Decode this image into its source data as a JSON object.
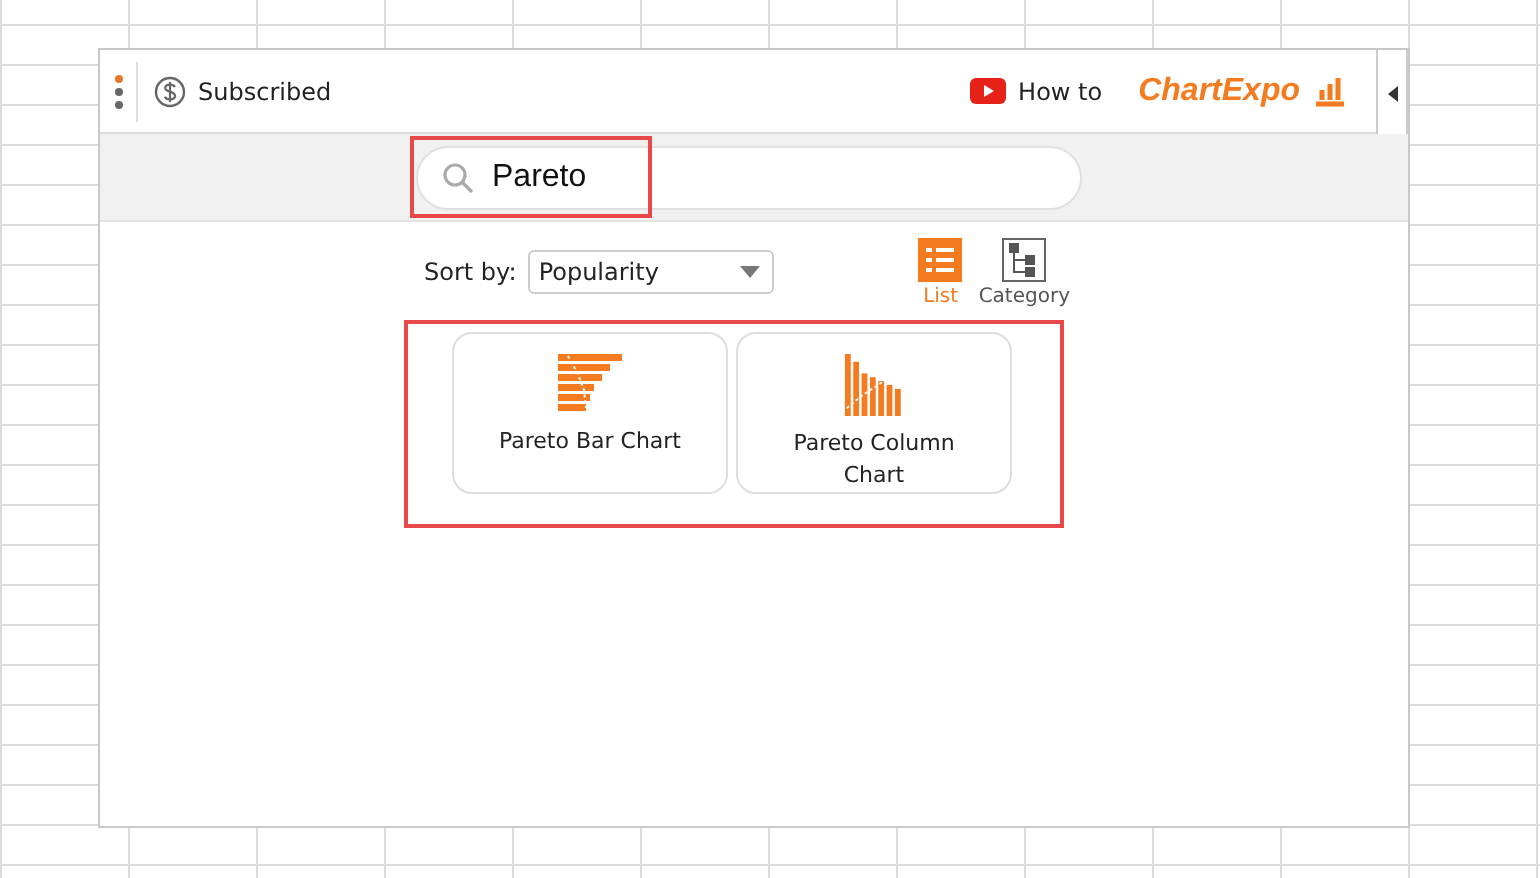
{
  "header": {
    "subscription": "Subscribed",
    "how_to": "How to",
    "logo": "ChartExpo"
  },
  "search": {
    "value": "Pareto"
  },
  "sort": {
    "label": "Sort by:",
    "value": "Popularity"
  },
  "view_modes": [
    {
      "label": "List",
      "kind": "list",
      "selected": true
    },
    {
      "label": "Category",
      "kind": "category",
      "selected": false
    }
  ],
  "charts": [
    {
      "label": "Pareto Bar Chart",
      "kind": "bar"
    },
    {
      "label": "Pareto Column Chart",
      "kind": "column"
    }
  ]
}
